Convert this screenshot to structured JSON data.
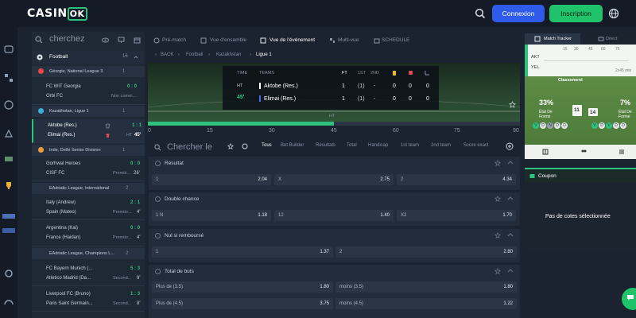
{
  "header": {
    "logo_text": "CASIN",
    "logo_ok": "OK",
    "login_label": "Connexion",
    "register_label": "Inscription",
    "colors": {
      "login": "#2f5bea",
      "register": "#20c26a",
      "accent": "#2ec27e"
    }
  },
  "sports_panel": {
    "search_placeholder": "cherchez",
    "sport_name": "Football",
    "sport_count": "16",
    "leagues": [
      {
        "name": "Géorgie, National League 3",
        "count": "1"
      },
      {
        "name": "Kazakhstan, Ligue 1",
        "count": "1"
      },
      {
        "name": "Inde, Delhi Senior Division",
        "count": "1"
      },
      {
        "name": "EAdriatic League, International",
        "count": "2"
      },
      {
        "name": "EAdriatic League, Champions L...",
        "count": "2"
      }
    ],
    "events": [
      {
        "home": "FC WIT Georgia",
        "away": "Orbi FC",
        "score_home": "0",
        "score_away": "0",
        "status": "Non comm...",
        "count": "1"
      },
      {
        "home": "Aktobe (Res.)",
        "away": "Elimai (Res.)",
        "score_home": "1",
        "score_away": "1",
        "status": "HT",
        "minute": "45'",
        "count": "1"
      },
      {
        "home": "Gorhwal Heroes",
        "away": "CISF FC",
        "score_home": "0",
        "score_away": "0",
        "status": "Premiè...",
        "minute": "26'",
        "count": "1"
      },
      {
        "home": "Italy (Andrew)",
        "away": "Spain (Mateo)",
        "score_home": "2",
        "score_away": "1",
        "status": "Premièr...",
        "minute": "4'",
        "count": "1"
      },
      {
        "home": "Argentina (Kai)",
        "away": "France (Haidan)",
        "score_home": "0",
        "score_away": "0",
        "status": "Premièr...",
        "minute": "4'",
        "count": "1"
      },
      {
        "home": "FC Bayern Munich (...",
        "away": "Atletico Madrid (Da...",
        "score_home": "5",
        "score_away": "3",
        "status": "Second...",
        "minute": "9'",
        "count": "1"
      },
      {
        "home": "Liverpool FC (Bruno)",
        "away": "Paris Saint Germain...",
        "score_home": "1",
        "score_away": "3",
        "status": "Second...",
        "minute": "8'",
        "count": "1"
      }
    ]
  },
  "center": {
    "tabs": [
      "Pré-match",
      "Vue d'ensamble",
      "Vue de l'événement",
      "Multi-vue",
      "SCHEDULE"
    ],
    "breadcrumb": [
      "BACK",
      "Football",
      "Kazakhstan",
      "Ligue 1"
    ],
    "scoreboard": {
      "time_label": "TIME",
      "teams_label": "TEAMS",
      "ft": "FT",
      "first": "1ST",
      "second": "2ND",
      "period": "HT",
      "minute": "45'",
      "rows": [
        {
          "team": "Aktobe (Res.)",
          "ft": "1",
          "first": "(1)",
          "second": "-",
          "c1": "0",
          "c2": "0",
          "c3": "0"
        },
        {
          "team": "Elimai (Res.)",
          "ft": "1",
          "first": "(1)",
          "second": "-",
          "c1": "0",
          "c2": "0",
          "c3": "0"
        }
      ]
    },
    "timeline": {
      "labels": [
        "0",
        "15",
        "30",
        "45",
        "60",
        "75",
        "90"
      ],
      "ht_label": "HT",
      "progress": 0.5
    },
    "search_placeholder": "Chercher le",
    "filters": [
      "Tous",
      "Bet Builder",
      "Résultats",
      "Total",
      "Handicap",
      "1st team",
      "2nd team",
      "Score exact"
    ],
    "markets": [
      {
        "title": "Résultat",
        "odds": [
          {
            "label": "1",
            "value": "2.04"
          },
          {
            "label": "X",
            "value": "2.75"
          },
          {
            "label": "2",
            "value": "4.34"
          }
        ]
      },
      {
        "title": "Double chance",
        "odds": [
          {
            "label": "1 N",
            "value": "1.18"
          },
          {
            "label": "12",
            "value": "1.40"
          },
          {
            "label": "X2",
            "value": "1.70"
          }
        ]
      },
      {
        "title": "Nul si remboursé",
        "odds": [
          {
            "label": "1",
            "value": "1.37"
          },
          {
            "label": "2",
            "value": "2.80"
          }
        ]
      },
      {
        "title": "Total de buts",
        "rows": [
          [
            {
              "label": "Plus de (3.5)",
              "value": "1.80"
            },
            {
              "label": "moins (3.5)",
              "value": "1.80"
            }
          ],
          [
            {
              "label": "Plus de (4.5)",
              "value": "3.75"
            },
            {
              "label": "moins (4.5)",
              "value": "1.22"
            }
          ]
        ]
      }
    ]
  },
  "tracker": {
    "tab_tracker": "Match Tracker",
    "tab_direct": "Direct",
    "akt": "AKT",
    "yel": "YEL",
    "scale": [
      "15",
      "30",
      "45",
      "60",
      "75"
    ],
    "note": "2x45 min",
    "classement": "Classement",
    "left_pct": "33%",
    "left_label": "État De Forme",
    "right_pct": "7%",
    "right_label": "État De Forme",
    "pos_left": "11",
    "pos_right": "14",
    "form_left": [
      "V",
      "D",
      "N",
      "D",
      "D"
    ],
    "form_right": [
      "V",
      "D",
      "V",
      "D",
      "D"
    ]
  },
  "coupon": {
    "title": "Coupon",
    "empty_text": "Pas de cotes sélectionnée"
  }
}
